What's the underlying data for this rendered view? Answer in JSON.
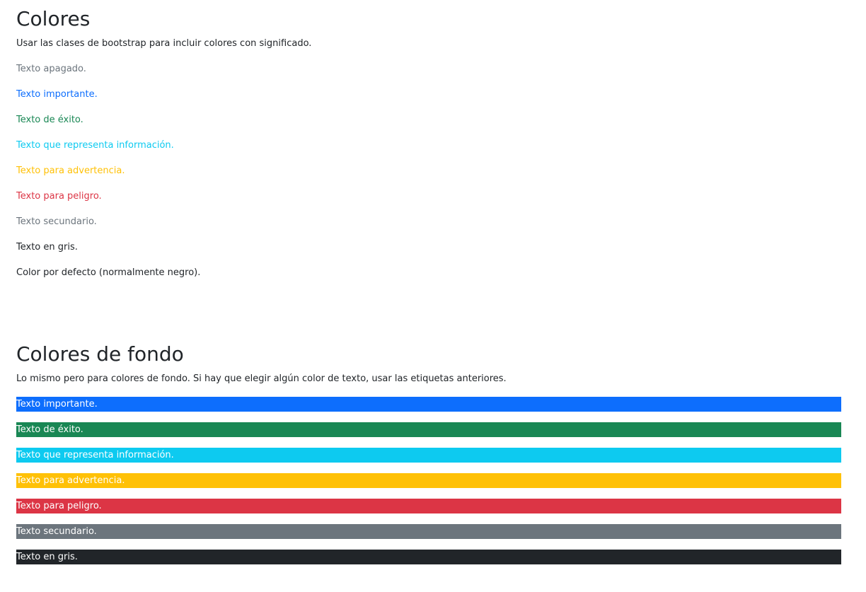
{
  "section_text_colors": {
    "title": "Colores",
    "intro": "Usar las clases de bootstrap para incluir colores con significado.",
    "items": [
      {
        "label": "Texto apagado.",
        "color": "#6c757d"
      },
      {
        "label": "Texto importante.",
        "color": "#0d6efd"
      },
      {
        "label": "Texto de éxito.",
        "color": "#198754"
      },
      {
        "label": "Texto que representa información.",
        "color": "#0dcaf0"
      },
      {
        "label": "Texto para advertencia.",
        "color": "#ffc107"
      },
      {
        "label": "Texto para peligro.",
        "color": "#dc3545"
      },
      {
        "label": "Texto secundario.",
        "color": "#6c757d"
      },
      {
        "label": "Texto en gris.",
        "color": "#212529"
      },
      {
        "label": "Color por defecto (normalmente negro).",
        "color": "#212529"
      }
    ]
  },
  "section_background_colors": {
    "title": "Colores de fondo",
    "intro": "Lo mismo pero para colores de fondo. Si hay que elegir algún color de texto, usar las etiquetas anteriores.",
    "items": [
      {
        "label": "Texto importante.",
        "background": "#0d6efd"
      },
      {
        "label": "Texto de éxito.",
        "background": "#198754"
      },
      {
        "label": "Texto que representa información.",
        "background": "#0dcaf0"
      },
      {
        "label": "Texto para advertencia.",
        "background": "#ffc107"
      },
      {
        "label": "Texto para peligro.",
        "background": "#dc3545"
      },
      {
        "label": "Texto secundario.",
        "background": "#6c757d"
      },
      {
        "label": "Texto en gris.",
        "background": "#212529"
      }
    ]
  }
}
